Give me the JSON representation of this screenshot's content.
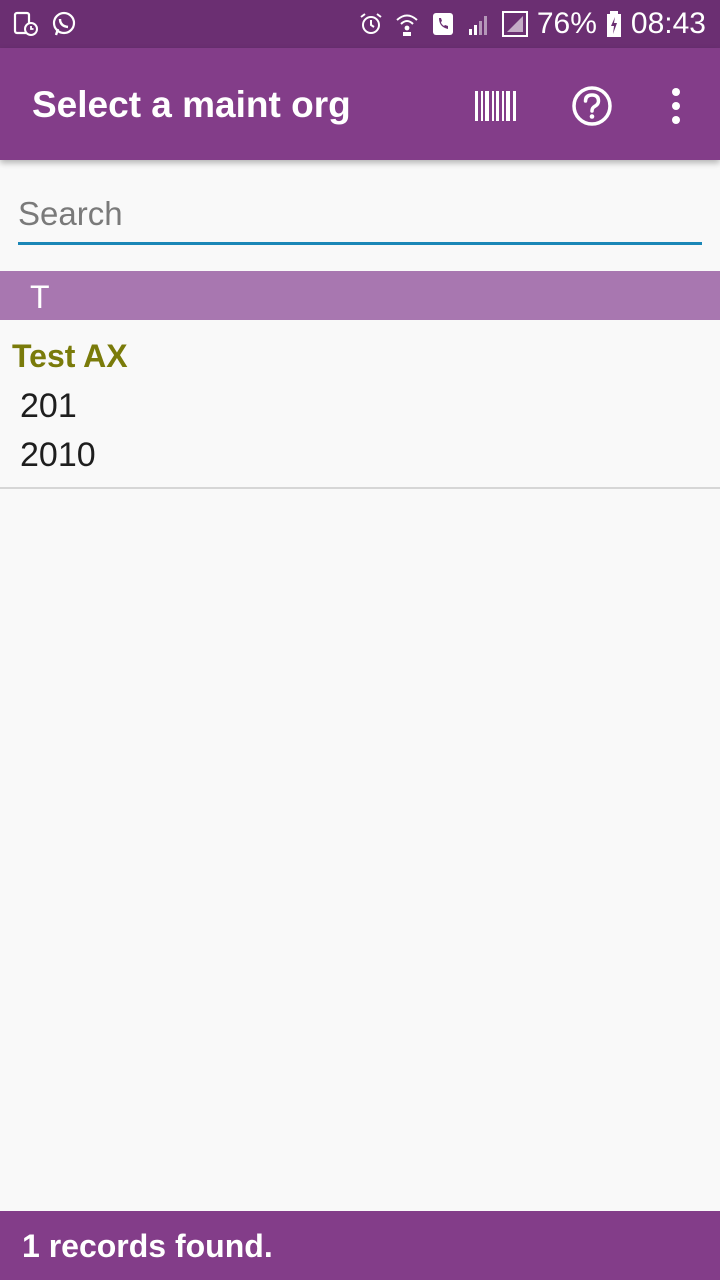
{
  "status_bar": {
    "left_icons": [
      "device-clock-icon",
      "whatsapp-icon"
    ],
    "right_icons": [
      "alarm-icon",
      "wifi-call-icon",
      "phone-icon",
      "signal-icon",
      "sim-signal-icon",
      "battery-charging-icon"
    ],
    "battery_percent": "76%",
    "time": "08:43"
  },
  "app_bar": {
    "title": "Select a maint org",
    "actions": [
      "barcode-icon",
      "help-icon",
      "more-vert-icon"
    ],
    "background": "#833d89"
  },
  "search": {
    "placeholder": "Search",
    "value": "",
    "underline_color": "#1b87b7"
  },
  "list": {
    "section_header": "T",
    "section_color": "#a877b0",
    "items": [
      {
        "title": "Test AX",
        "line1": "201",
        "line2": "2010",
        "title_color": "#7a7b0a"
      }
    ]
  },
  "footer": {
    "text": "1 records found."
  }
}
